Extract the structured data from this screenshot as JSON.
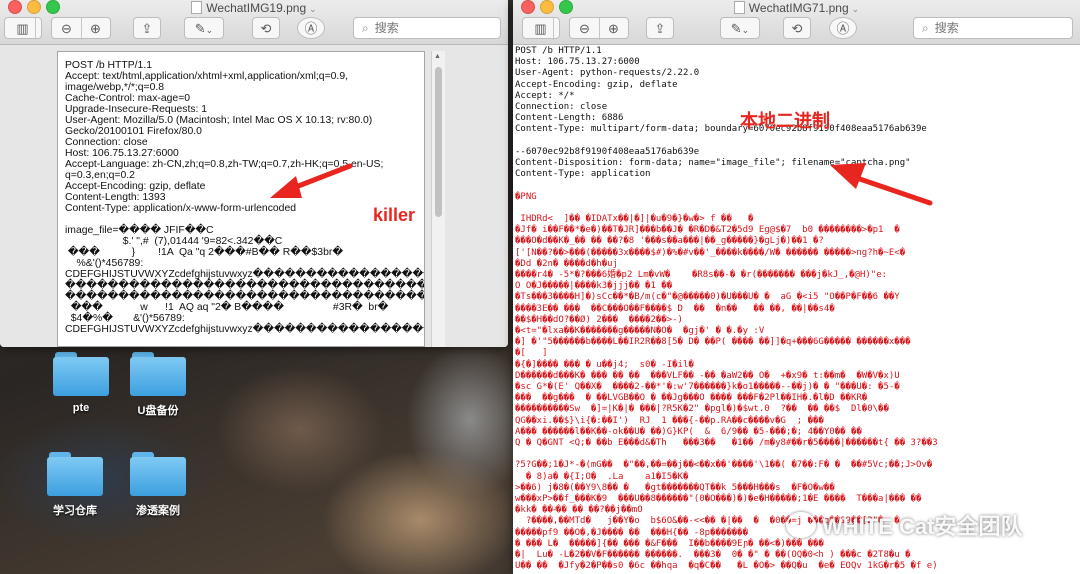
{
  "colors": {
    "close": "#fc605c",
    "minimize": "#fdbc40",
    "zoom": "#34c84a",
    "annotation": "#e8261f",
    "binary": "#d9151b"
  },
  "desktop": {
    "icons": [
      {
        "label": "pte",
        "icon": "folder-icon"
      },
      {
        "label": "U盘备份",
        "icon": "folder-icon"
      },
      {
        "label": "学习仓库",
        "icon": "folder-icon"
      },
      {
        "label": "渗透案例",
        "icon": "folder-icon"
      }
    ]
  },
  "left_window": {
    "title": "WechatIMG19.png",
    "search_placeholder": "搜索",
    "lines": [
      "POST /b HTTP/1.1",
      "Accept: text/html,application/xhtml+xml,application/xml;q=0.9,",
      "image/webp,*/*;q=0.8",
      "Cache-Control: max-age=0",
      "Upgrade-Insecure-Requests: 1",
      "User-Agent: Mozilla/5.0 (Macintosh; Intel Mac OS X 10.13; rv:80.0)",
      "Gecko/20100101 Firefox/80.0",
      "Connection: close",
      "Host: 106.75.13.27:6000",
      "Accept-Language: zh-CN,zh;q=0.8,zh-TW;q=0.7,zh-HK;q=0.5,en-US;",
      "q=0.3,en;q=0.2",
      "Accept-Encoding: gzip, deflate",
      "Content-Length: 1393",
      "Content-Type: application/x-www-form-urlencoded",
      "",
      "image_file=���� JFIF��C",
      "                    $.' \",#  (7),01444 '9=82<.342��C",
      " ���           }        !1A  Qa \"q 2���#B�� R��$3br�",
      "    %&'()*456789:",
      "CDEFGHIJSTUVWXYZcdefghijstuvwxyz�������������������",
      "���������������������������������������",
      "���������������������������������������",
      "  ���             w      !1  AQ aq \"2� B����                 #3R�  br�",
      "  $4�%�       &'()*56789:",
      "CDEFGHIJSTUVWXYZcdefghijstuvwxyz�������������������"
    ],
    "annotation": "killer"
  },
  "right_window": {
    "title": "WechatIMG71.png",
    "search_placeholder": "搜索",
    "lines": [
      "POST /b HTTP/1.1",
      "Host: 106.75.13.27:6000",
      "User-Agent: python-requests/2.22.0",
      "Accept-Encoding: gzip, deflate",
      "Accept: */*",
      "Connection: close",
      "Content-Length: 6886",
      "Content-Type: multipart/form-data; boundary=6070ec92b8f9190f408eaa5176ab639e",
      "",
      "--6070ec92b8f9190f408eaa5176ab639e",
      "Content-Disposition: form-data; name=\"image_file\"; filename=\"captcha.png\"",
      "Content-Type: application",
      ""
    ],
    "binary_lines": [
      "�PNG",
      "",
      " IHDRd<  ]�� �IDATx��|�]|�u�9�}�w�> f ��   �",
      "�Jf� i��F��*�e�)��T�JR]���b��J� �R�D�&T2�5d9 Eg@$�7  b0 ��������>�p1  �",
      "���O�d��K�_�� �� ��?�8 '���s��a���|��_g�����}�gLj�)��1 �?",
      "['[N��?��>���(�����3x����$#)�%�#v��'_����k����/W� ������ �����>ng?h�~E<�",
      "�Dd �2n� ����d�h�uj",
      "����r4� -5*�?���6婚�p2 Lm�vW�    �R8s��-� �r(������� ���j�kJ_,�@H)\"e:",
      "O O�J�����|����k3�jjj�� �1 ��",
      "�Ts���3����H]�)sCc��*�B/m(c�\"�@�����0)�U���U� �  aG �<i5 \"O��P�F��6 ��Y",
      "����3E�� ���  ��C���O��F����$ D  ��  �n��   �� ��, ��|��s4�",
      "��$�H��dO?��Ø) 2���  ����2��>-)",
      "�<t=\"�lxa��K�������g�����N�O�  �gj�' � �.�y :V",
      "�] �'\"5������b����L��IR2R��8[5� D� ��P( ���� ��]]�q+���6G����� ������x���",
      "�[   ]",
      "�{�]���� ��� � u��j4;  s0� -I�il�",
      "D������d���K� ��� �� ��  ���VLF�� -�� �aW2�� O�  +�x9� t:��m�  �W�V�x)U",
      "�sc G*�(E' Q��X�  ����2-��*'�:w'7������}k�o1�����--��j)� � \"���U�: �5-�",
      "���  ��g���  � ��LVGB��O � ��Jg���O ���� ���F�2Pl��IH�.�l�D ��KR�",
      "����������Sw  �]=|K�|� ���|?R5K�2\" �pgl�)�$wt.0  ?��  �� ��$  Dl�0\\��",
      "QG��xi.��$}\\i{�:��I')  RJ  1 ���{-��p.RA��c����v�G  ; ���",
      "A��� ������l��K��-ok��U� ��)G}KP(  &  6/9�� �5-���;�; 4��Y0�� ��",
      "Q � Q�GNT <Q;� ��b E���d&�Th   ���3��   �1�� /m�y8#��r�5����|������t{ �� 3?��3",
      "",
      "?5?G��;1�J*-�(mG��  �\"��,��=��j��<��x��'����'\\1��( �7��:F� �  ��#5Vc;��;J>Ov�",
      "  � 8)a� �{I;O�  .La    a1�I5�K�",
      ">��6) j�8�(��Y9\\8�� �   �gt�������QT��k 5���H���s  �F�O�w��",
      "w���xP>��f_���K�9  ���U��8������\"(0�O���)�)�e�H�����;1�E ����  T���a|��� ��",
      "�kk� ��-ͯ�� �� ��?��j��mO",
      "  ?����,��MTd�   j��Y�o  b$6O&��-<<�� �|��  �  �0��=j ���q��&9��[2\"�  �",
      "�����pf9 ��O�,�J���� ��  ���H{�� -8p�������",
      "� ��� L�  �����]{�� ��� �&F���  I��b����9Eɲ� ��<�)��� ���",
      "�|  Lu� -L�2��V�F������ ������.  ���3�  0� �\" � ��(OQ�0<h ) ���c �2T8�u �",
      "U�� ��  �Jfy�2�P��s0 �6c ��hqa  �q�C��   �L �O�> ��Q�u  �e� EOQv 1kG�r�5 �f e)"
    ],
    "annotation": "本地二进制"
  },
  "watermark": {
    "text": "WHITE Cat安全团队"
  }
}
